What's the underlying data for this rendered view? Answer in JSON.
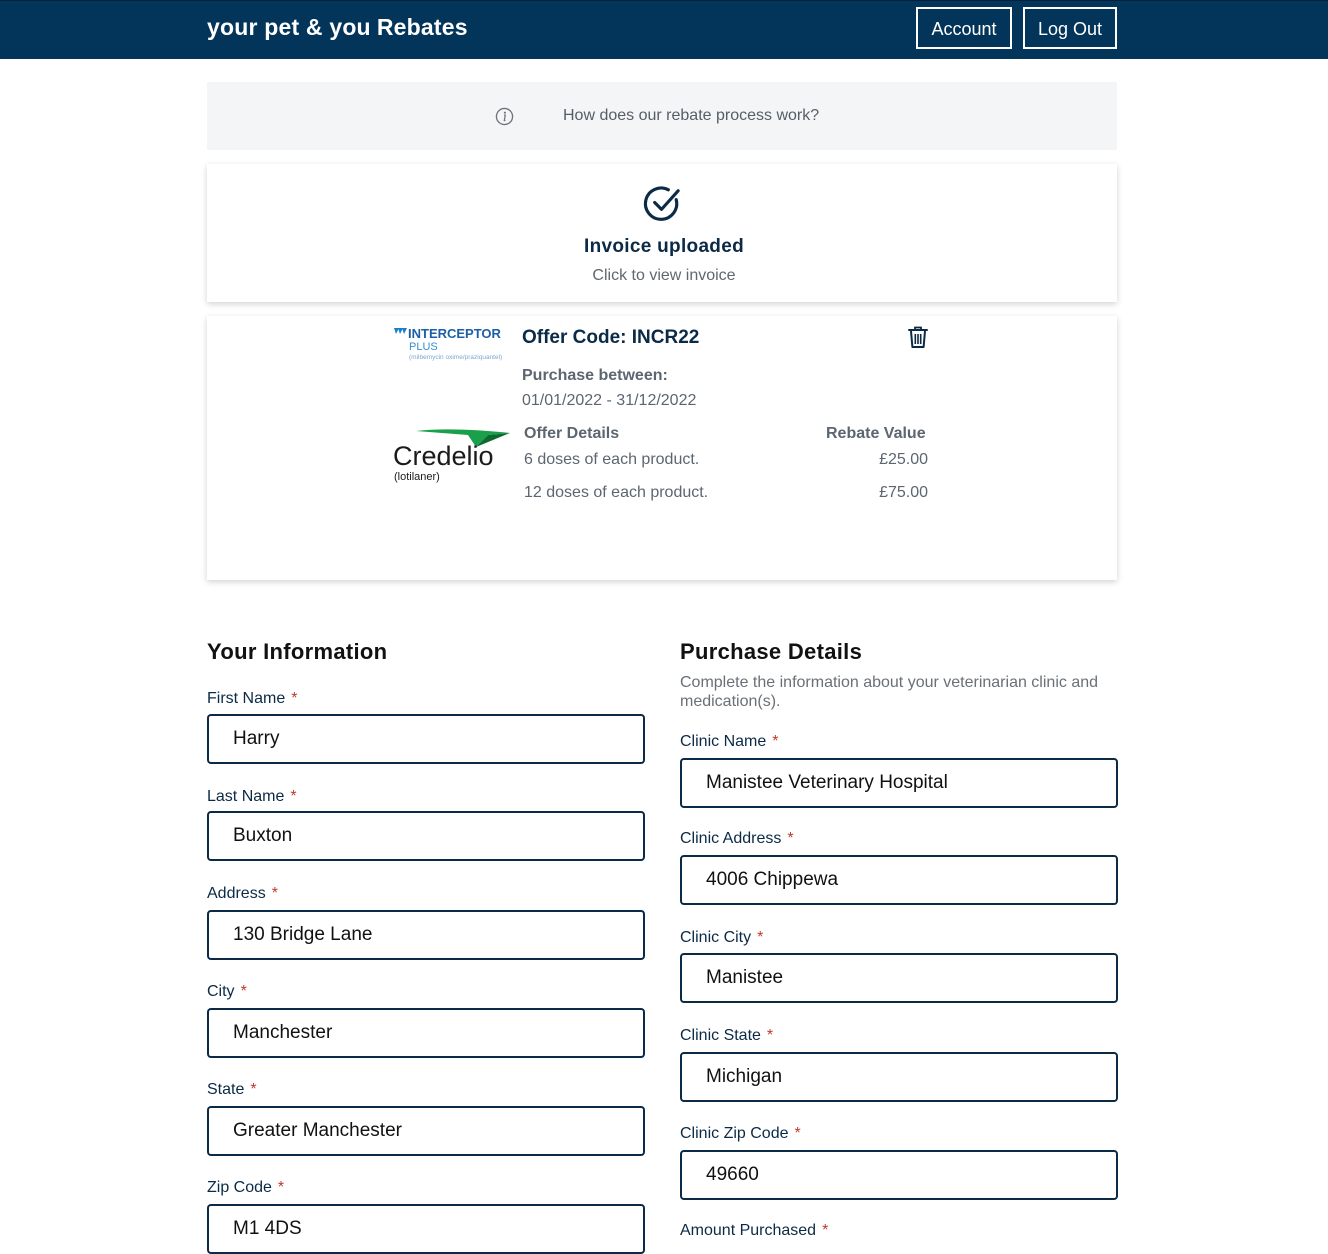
{
  "header": {
    "brand_part1": "your pet & you",
    "brand_part2": "Rebates",
    "account_label": "Account",
    "logout_label": "Log Out"
  },
  "info": {
    "text": "How does our rebate process work?",
    "icon": "info-circle-icon"
  },
  "upload": {
    "title": "Invoice uploaded",
    "subtitle": "Click to view invoice",
    "icon": "check-circle-icon"
  },
  "offer": {
    "code_text": "Offer Code: INCR22",
    "purchase_label": "Purchase between:",
    "purchase_range": "01/01/2022 - 31/12/2022",
    "details_header": "Offer Details",
    "rebate_header": "Rebate Value",
    "rows": [
      {
        "detail": "6 doses of each product.",
        "value": "£25.00"
      },
      {
        "detail": "12 doses of each product.",
        "value": "£75.00"
      }
    ],
    "logo1": {
      "name": "INTERCEPTOR",
      "sub": "PLUS",
      "fine": "(milbemycin oxime/praziquantel)"
    },
    "logo2": {
      "name": "Credelio",
      "sub": "(lotilaner)"
    }
  },
  "your_info": {
    "title": "Your Information",
    "fields": [
      {
        "label": "First Name",
        "value": "Harry"
      },
      {
        "label": "Last Name",
        "value": "Buxton"
      },
      {
        "label": "Address",
        "value": "130 Bridge Lane"
      },
      {
        "label": "City",
        "value": "Manchester"
      },
      {
        "label": "State",
        "value": "Greater Manchester"
      },
      {
        "label": "Zip Code",
        "value": "M1 4DS"
      }
    ]
  },
  "purchase_details": {
    "title": "Purchase Details",
    "description": "Complete the information about your veterinarian clinic and medication(s).",
    "fields": [
      {
        "label": "Clinic Name",
        "value": "Manistee Veterinary Hospital"
      },
      {
        "label": "Clinic Address",
        "value": "4006 Chippewa"
      },
      {
        "label": "Clinic City",
        "value": "Manistee"
      },
      {
        "label": "Clinic State",
        "value": "Michigan"
      },
      {
        "label": "Clinic Zip Code",
        "value": "49660"
      },
      {
        "label": "Amount Purchased",
        "value": ""
      }
    ]
  },
  "required_marker": "*",
  "colors": {
    "navbar": "#03355a",
    "accent": "#0b2a46",
    "required": "#c0392b"
  }
}
